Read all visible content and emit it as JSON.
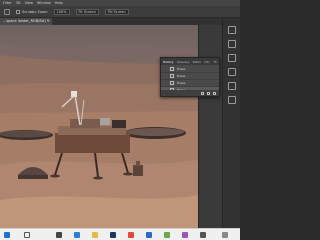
{
  "menubar": {
    "items": [
      "Filter",
      "3D",
      "View",
      "Window",
      "Help"
    ]
  },
  "options": {
    "checkbox_label": "",
    "zoom_field": "Scrubby Zoom",
    "size_label": "100%",
    "fit_label": "Fit Screen",
    "fill_label": "Fill Screen"
  },
  "document_tab": {
    "title": "...space lander_RGB/8#) *"
  },
  "history": {
    "tabs": [
      "History",
      "Glossary",
      "Paths",
      "Info"
    ],
    "rows": [
      "Erase",
      "Erase",
      "Erase",
      "Erase"
    ]
  },
  "colors": {
    "sky": "#8e7466",
    "ground": "#a57c66",
    "taskbar": "#f0f0f0",
    "panel": "#4a4a4a"
  },
  "taskbar": {
    "apps": [
      "start-icon",
      "search-icon",
      "taskview-icon",
      "edge-icon",
      "explorer-icon",
      "photoshop-icon",
      "chrome-icon",
      "mail-icon"
    ]
  }
}
